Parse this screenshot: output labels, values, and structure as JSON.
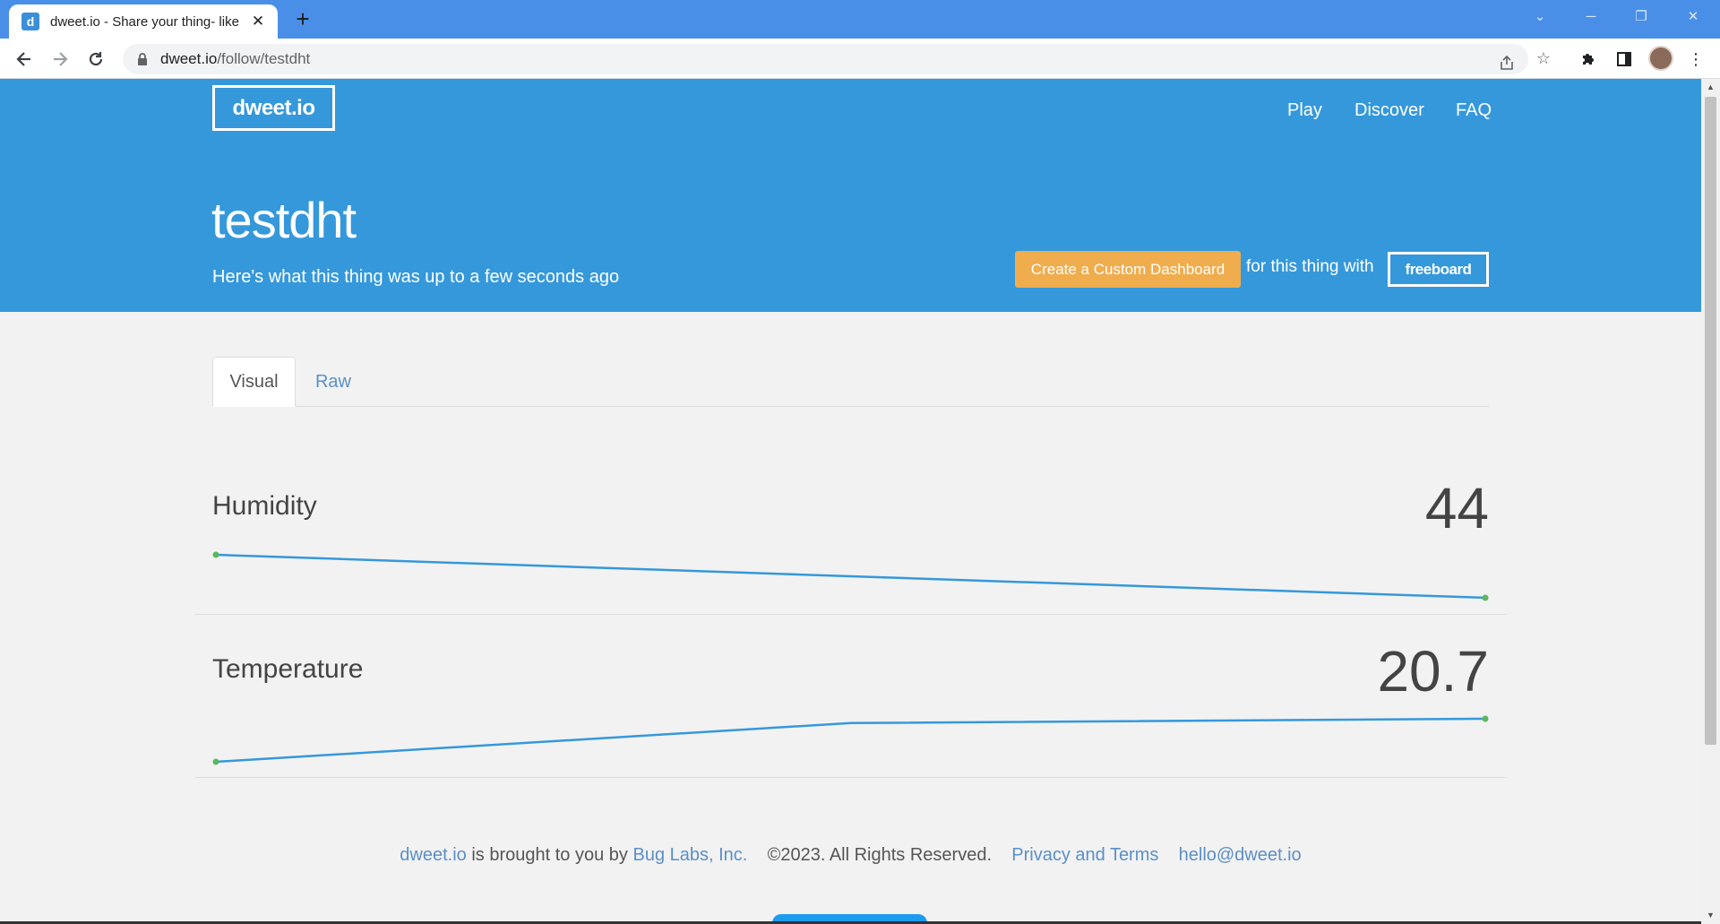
{
  "browser": {
    "tab_title": "dweet.io - Share your thing- like",
    "favicon_letter": "d",
    "url_host": "dweet.io",
    "url_path": "/follow/testdht",
    "new_tab": "+",
    "close_tab": "✕"
  },
  "header": {
    "logo": "dweet.io",
    "nav": [
      "Play",
      "Discover",
      "FAQ"
    ],
    "thing_name": "testdht",
    "subtitle": "Here's what this thing was up to a few seconds ago",
    "dashboard_button": "Create a Custom Dashboard",
    "for_text": "for this thing with",
    "freeboard": "freeboard"
  },
  "tabs": {
    "visual": "Visual",
    "raw": "Raw"
  },
  "metrics": [
    {
      "name": "Humidity",
      "value": "44",
      "series": [
        46,
        45,
        44
      ]
    },
    {
      "name": "Temperature",
      "value": "20.7",
      "series": [
        19.7,
        20.6,
        20.7
      ]
    }
  ],
  "footer": {
    "site": "dweet.io",
    "brought": "is brought to you by",
    "company": "Bug Labs, Inc.",
    "copyright": "©2023. All Rights Reserved.",
    "privacy": "Privacy and Terms",
    "email": "hello@dweet.io"
  },
  "colors": {
    "header_bg": "#3598db",
    "button_orange": "#f0ad4e",
    "line_blue": "#3598db",
    "point_green": "#5cb85c"
  }
}
